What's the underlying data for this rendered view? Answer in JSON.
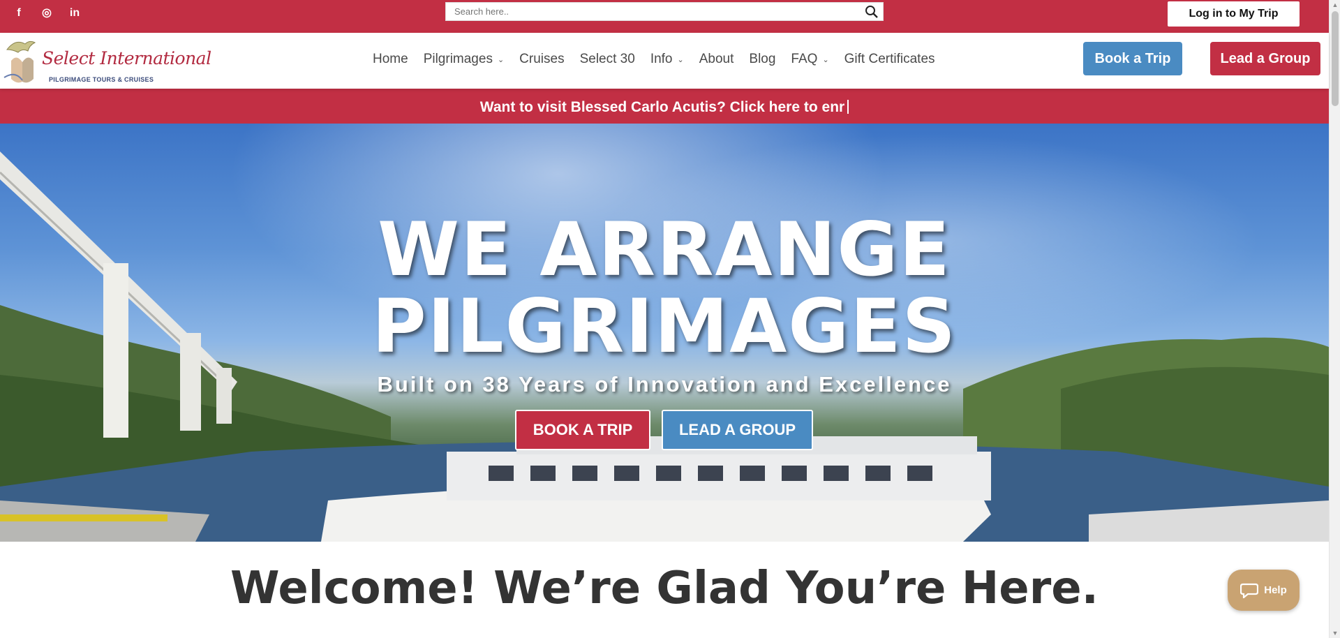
{
  "topbar": {
    "social": [
      "f",
      "◎",
      "in"
    ],
    "search_placeholder": "Search here..",
    "login_label": "Log in to My Trip"
  },
  "header": {
    "logo_title": "Select International",
    "logo_subtitle": "PILGRIMAGE TOURS & CRUISES",
    "nav": [
      {
        "label": "Home",
        "dropdown": false
      },
      {
        "label": "Pilgrimages",
        "dropdown": true
      },
      {
        "label": "Cruises",
        "dropdown": false
      },
      {
        "label": "Select 30",
        "dropdown": false
      },
      {
        "label": "Info",
        "dropdown": true
      },
      {
        "label": "About",
        "dropdown": false
      },
      {
        "label": "Blog",
        "dropdown": false
      },
      {
        "label": "FAQ",
        "dropdown": true
      },
      {
        "label": "Gift Certificates",
        "dropdown": false
      }
    ],
    "book_label": "Book a Trip",
    "lead_label": "Lead a Group"
  },
  "announcement": "Want to visit Blessed Carlo Acutis? Click here to enr",
  "hero": {
    "title_line1": "WE ARRANGE",
    "title_line2": "PILGRIMAGES",
    "subtitle": "Built on 38 Years of Innovation and Excellence",
    "book_label": "BOOK A TRIP",
    "lead_label": "LEAD A GROUP"
  },
  "welcome": "Welcome! We’re Glad You’re Here.",
  "help_label": "Help",
  "colors": {
    "brand_red": "#c22f44",
    "brand_blue": "#4a8bc2",
    "help_tan": "#c9a372"
  }
}
